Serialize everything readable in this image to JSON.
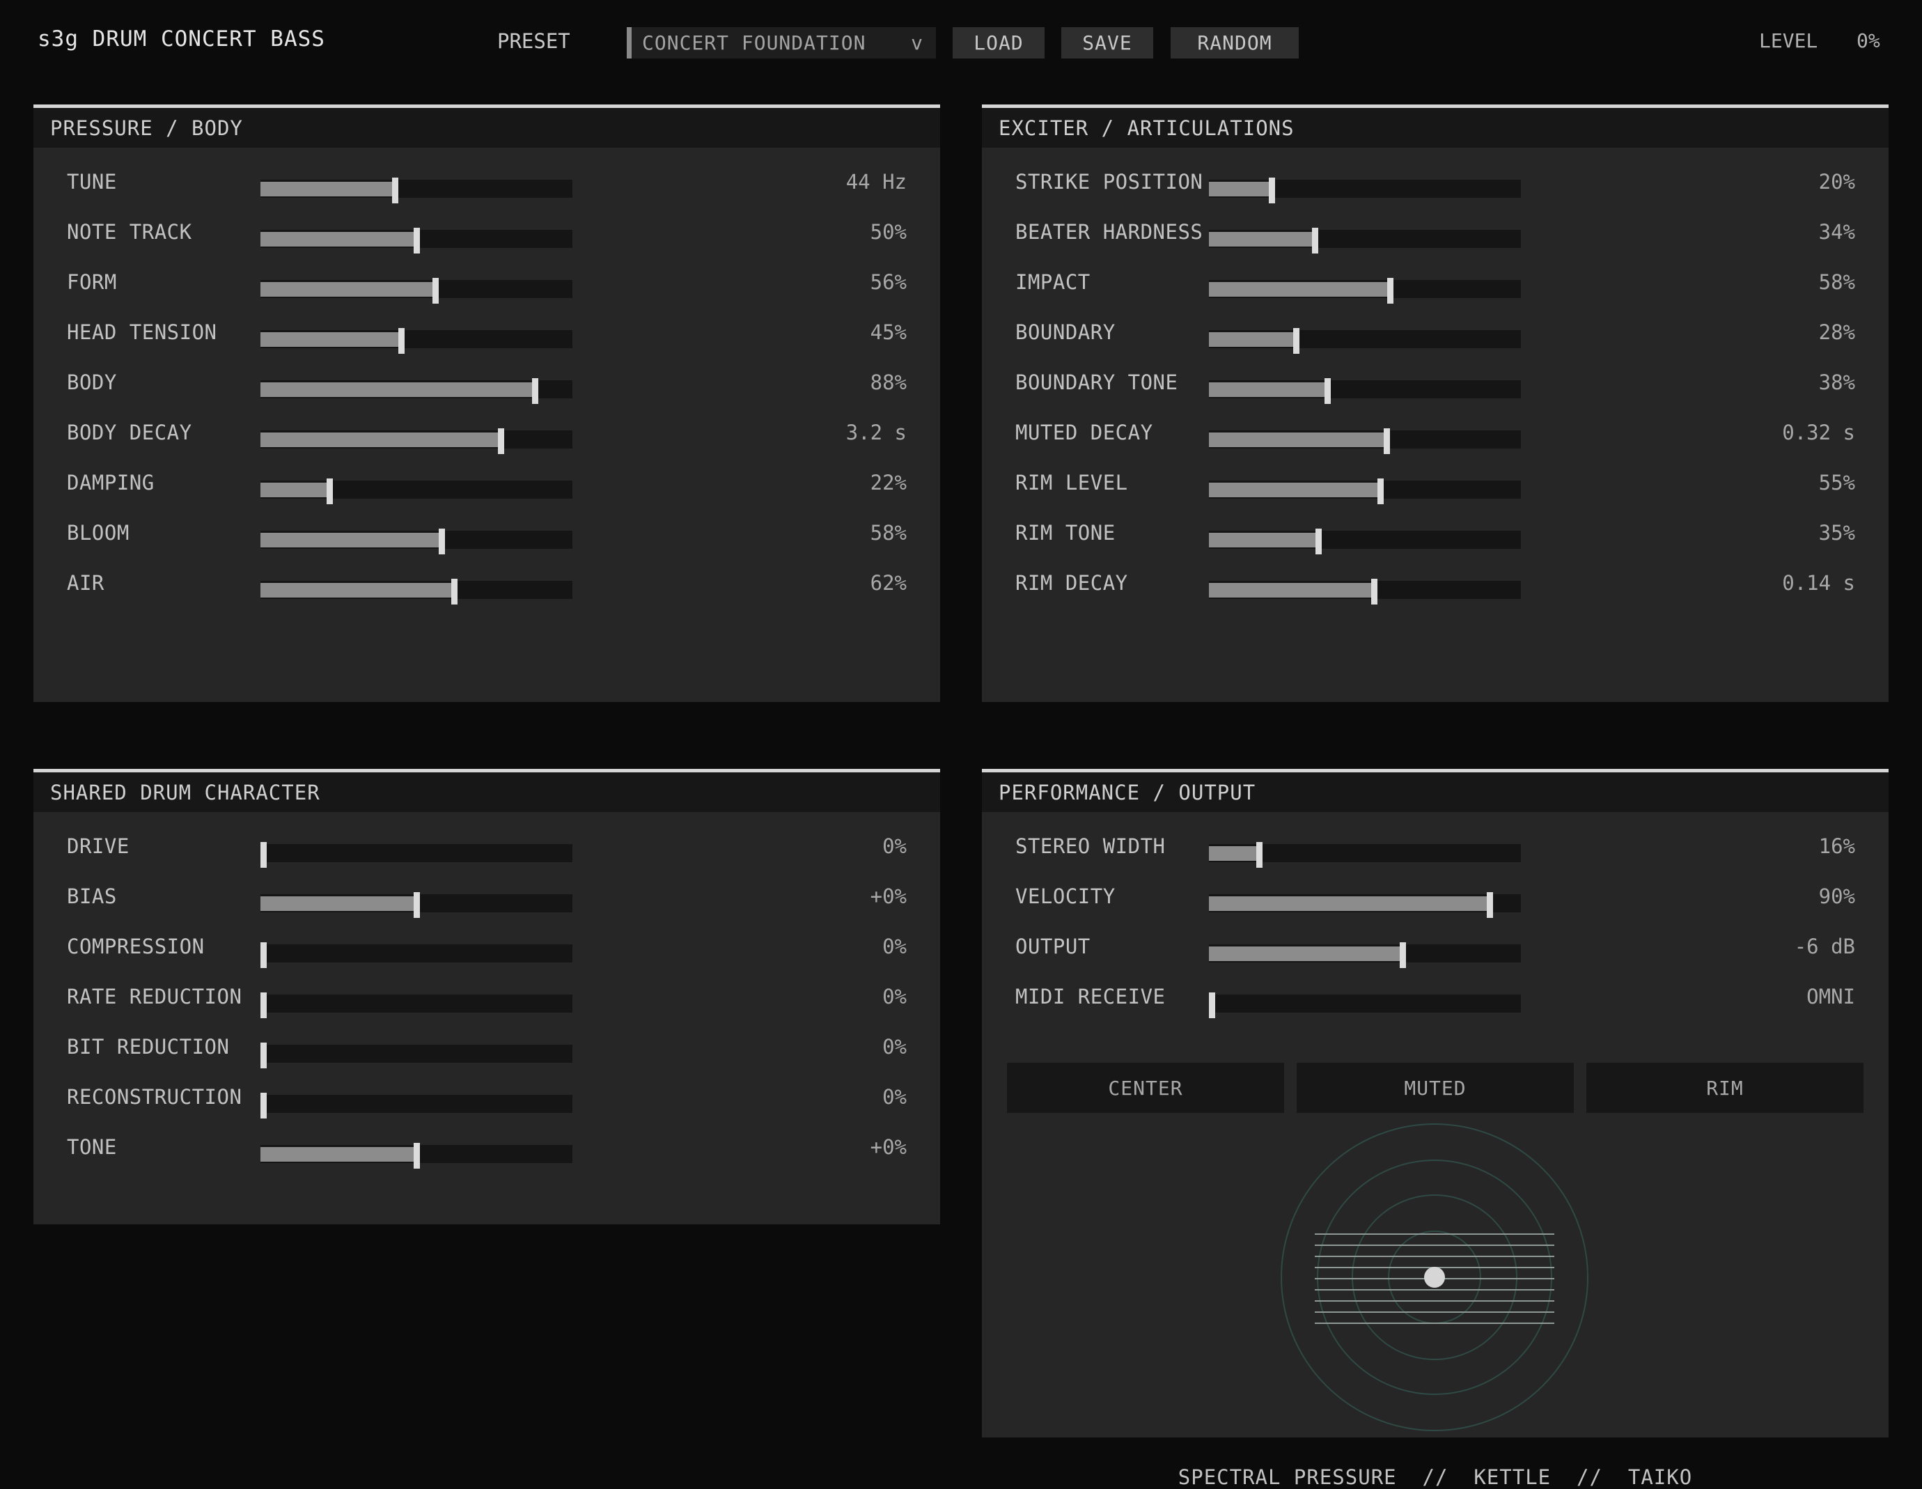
{
  "header": {
    "title": "s3g DRUM CONCERT BASS",
    "preset_label": "PRESET",
    "preset_value": "CONCERT FOUNDATION",
    "preset_arrow": "v",
    "load_label": "LOAD",
    "save_label": "SAVE",
    "random_label": "RANDOM",
    "level_label": "LEVEL",
    "level_value": "0%"
  },
  "panels": {
    "pressure": {
      "title": "PRESSURE / BODY",
      "params": [
        {
          "name": "TUNE",
          "value": "44 Hz",
          "level": 0.43
        },
        {
          "name": "NOTE TRACK",
          "value": "50%",
          "level": 0.5
        },
        {
          "name": "FORM",
          "value": "56%",
          "level": 0.56
        },
        {
          "name": "HEAD TENSION",
          "value": "45%",
          "level": 0.45
        },
        {
          "name": "BODY",
          "value": "88%",
          "level": 0.88
        },
        {
          "name": "BODY DECAY",
          "value": "3.2 s",
          "level": 0.77
        },
        {
          "name": "DAMPING",
          "value": "22%",
          "level": 0.22
        },
        {
          "name": "BLOOM",
          "value": "58%",
          "level": 0.58
        },
        {
          "name": "AIR",
          "value": "62%",
          "level": 0.62
        }
      ]
    },
    "exciter": {
      "title": "EXCITER / ARTICULATIONS",
      "params": [
        {
          "name": "STRIKE POSITION",
          "value": "20%",
          "level": 0.2
        },
        {
          "name": "BEATER HARDNESS",
          "value": "34%",
          "level": 0.34
        },
        {
          "name": "IMPACT",
          "value": "58%",
          "level": 0.58
        },
        {
          "name": "BOUNDARY",
          "value": "28%",
          "level": 0.28
        },
        {
          "name": "BOUNDARY TONE",
          "value": "38%",
          "level": 0.38
        },
        {
          "name": "MUTED DECAY",
          "value": "0.32 s",
          "level": 0.57
        },
        {
          "name": "RIM LEVEL",
          "value": "55%",
          "level": 0.55
        },
        {
          "name": "RIM TONE",
          "value": "35%",
          "level": 0.35
        },
        {
          "name": "RIM DECAY",
          "value": "0.14 s",
          "level": 0.53
        }
      ]
    },
    "character": {
      "title": "SHARED DRUM CHARACTER",
      "params": [
        {
          "name": "DRIVE",
          "value": "0%",
          "level": 0.0
        },
        {
          "name": "BIAS",
          "value": "+0%",
          "level": 0.5
        },
        {
          "name": "COMPRESSION",
          "value": "0%",
          "level": 0.0
        },
        {
          "name": "RATE REDUCTION",
          "value": "0%",
          "level": 0.0
        },
        {
          "name": "BIT REDUCTION",
          "value": "0%",
          "level": 0.0
        },
        {
          "name": "RECONSTRUCTION",
          "value": "0%",
          "level": 0.0
        },
        {
          "name": "TONE",
          "value": "+0%",
          "level": 0.5
        }
      ]
    },
    "performance": {
      "title": "PERFORMANCE / OUTPUT",
      "params": [
        {
          "name": "STEREO WIDTH",
          "value": "16%",
          "level": 0.16
        },
        {
          "name": "VELOCITY",
          "value": "90%",
          "level": 0.9
        },
        {
          "name": "OUTPUT",
          "value": "-6 dB",
          "level": 0.62
        },
        {
          "name": "MIDI RECEIVE",
          "value": "OMNI",
          "level": 0.0
        }
      ],
      "zones": [
        "CENTER",
        "MUTED",
        "RIM"
      ],
      "caption": "SPECTRAL PRESSURE  //  KETTLE  //  TAIKO"
    }
  },
  "colors": {
    "background": "#0b0b0b",
    "panel": "#262626",
    "panel_header": "#171717",
    "slider_fill": "#8c8c8c",
    "slider_handle": "#dcdcdc",
    "pad_rings": "#2f4a44"
  }
}
